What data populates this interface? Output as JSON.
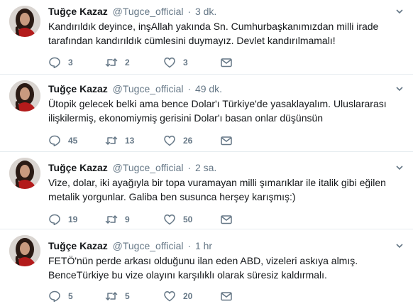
{
  "tweets": [
    {
      "name": "Tuğçe Kazaz",
      "handle": "@Tugce_official",
      "separator": "·",
      "time": "3 dk.",
      "lines": [
        "Kandırıldık deyince, inşAllah yakında Sn. Cumhurbaşkanımızdan milli irade",
        "tarafından kandırıldık cümlesini  duymayız. Devlet kandırılmamalı!"
      ],
      "replies": "3",
      "retweets": "2",
      "likes": "3"
    },
    {
      "name": "Tuğçe Kazaz",
      "handle": "@Tugce_official",
      "separator": "·",
      "time": "49 dk.",
      "lines": [
        "Ütopik gelecek belki ama bence Dolar'ı Türkiye'de yasaklayalım. Uluslararası",
        "ilişkilermiş, ekonomiymiş gerisini Dolar'ı basan onlar düşünsün"
      ],
      "replies": "45",
      "retweets": "13",
      "likes": "26"
    },
    {
      "name": "Tuğçe Kazaz",
      "handle": "@Tugce_official",
      "separator": "·",
      "time": "2 sa.",
      "lines": [
        "Vize, dolar, iki ayağıyla bir topa vuramayan milli şımarıklar ile italik gibi eğilen",
        "metalik yorgunlar. Galiba ben susunca herşey karışmış:)"
      ],
      "replies": "19",
      "retweets": "9",
      "likes": "50"
    },
    {
      "name": "Tuğçe Kazaz",
      "handle": "@Tugce_official",
      "separator": "·",
      "time": "1 hr",
      "lines": [
        "FETÖ'nün perde arkası olduğunu ilan eden ABD, vizeleri askıya almış.",
        "BenceTürkiye bu vize olayını karşılıklı olarak süresiz kaldırmalı."
      ],
      "replies": "5",
      "retweets": "5",
      "likes": "20"
    }
  ],
  "icons": {
    "reply": "reply-icon",
    "retweet": "retweet-icon",
    "like": "heart-icon",
    "message": "envelope-icon",
    "more": "chevron-down-icon"
  },
  "colors": {
    "text": "#14171a",
    "secondary": "#657786",
    "divider": "#e6ecf0"
  }
}
